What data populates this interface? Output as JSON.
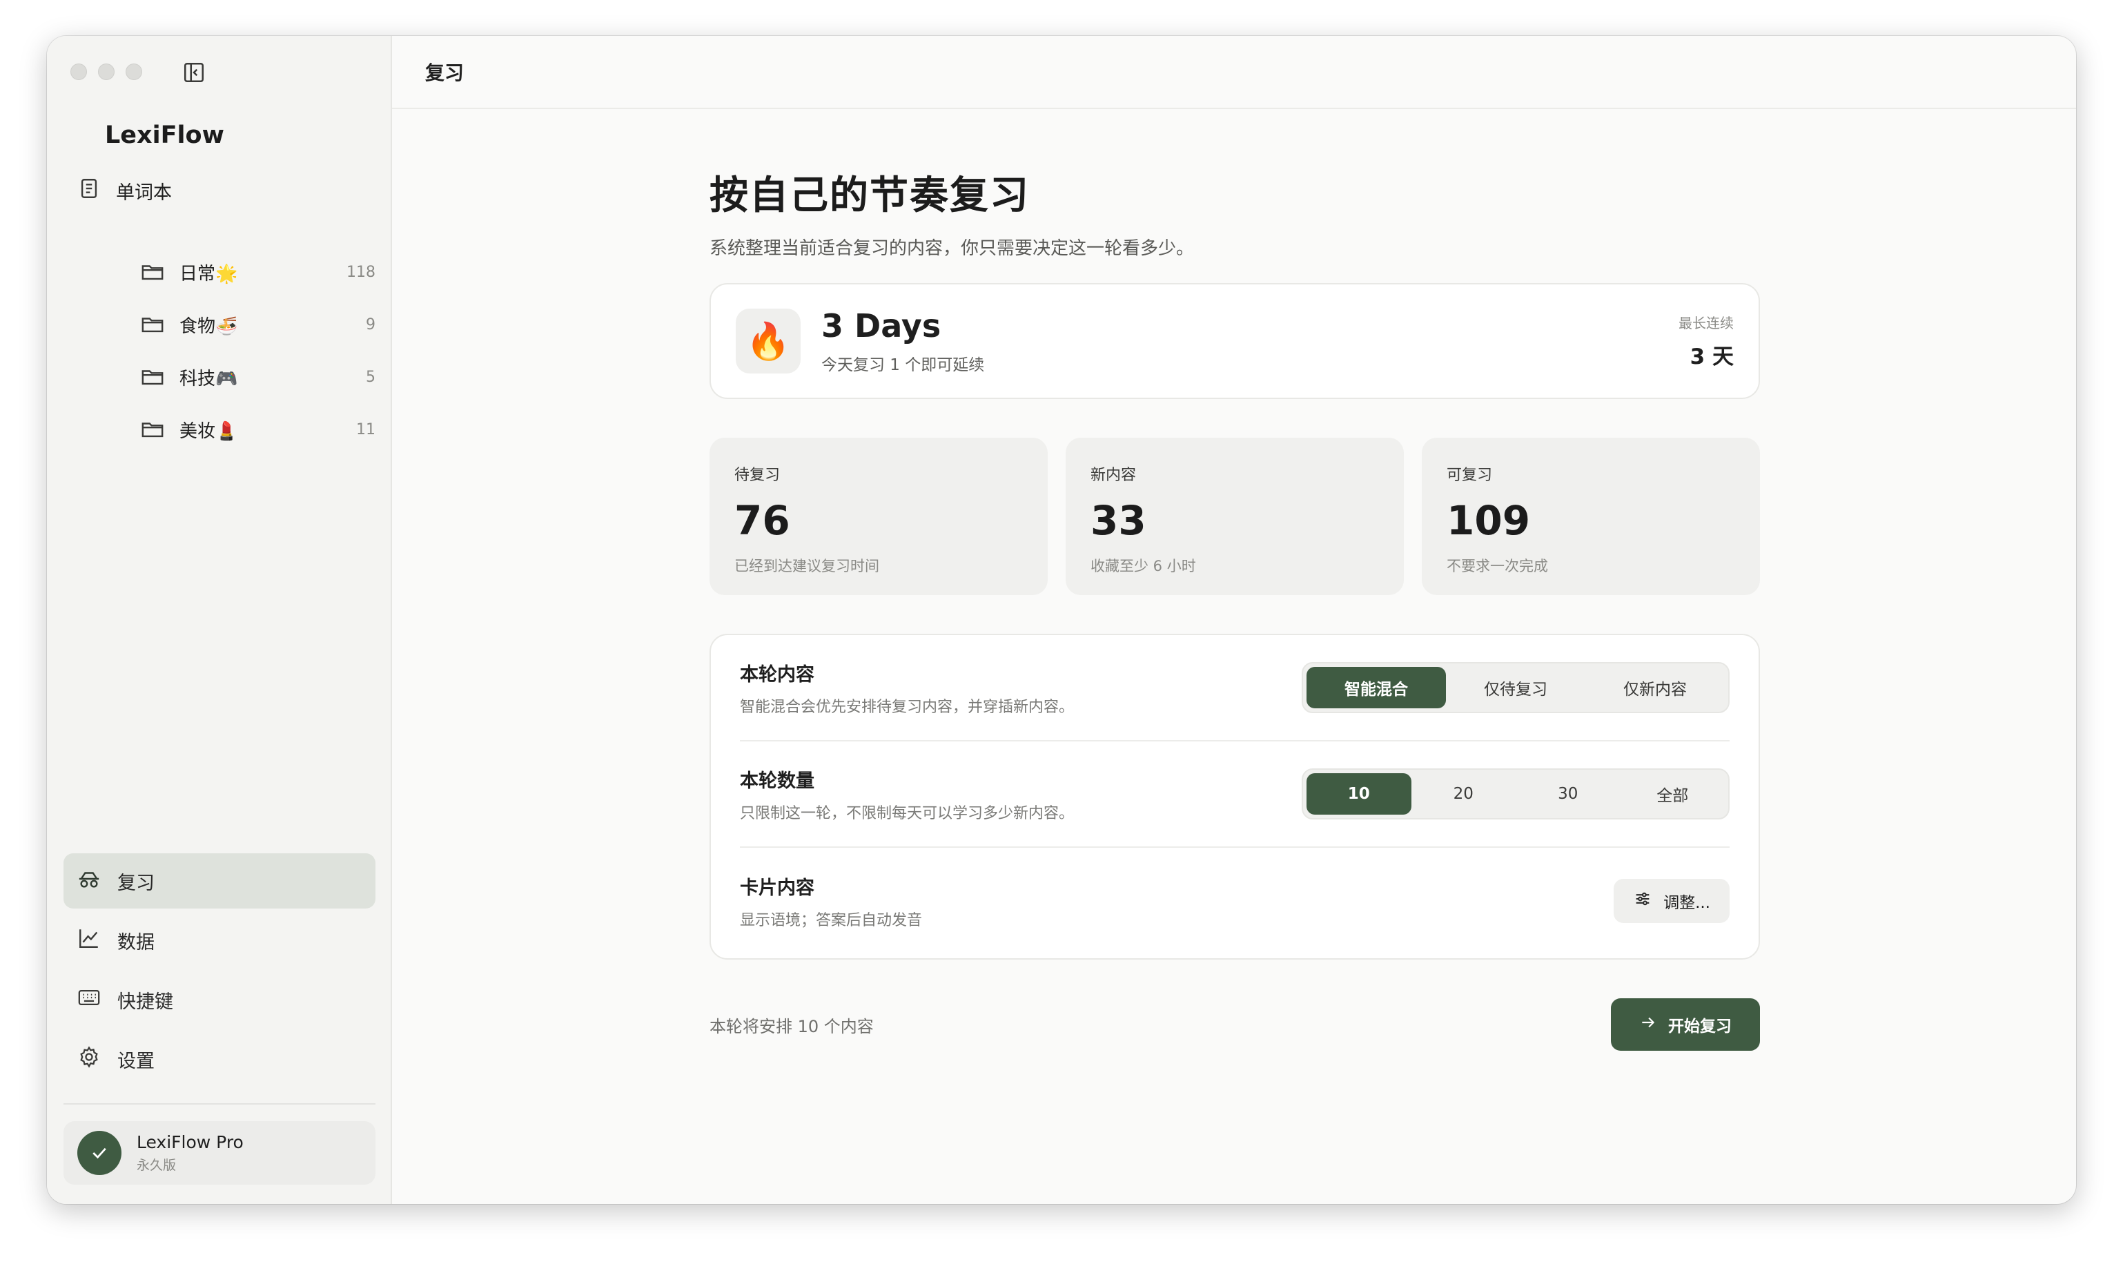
{
  "app": {
    "name": "LexiFlow"
  },
  "sidebar": {
    "wordbook_label": "单词本",
    "folders": [
      {
        "name": "日常🌟",
        "count": "118"
      },
      {
        "name": "食物🍜",
        "count": "9"
      },
      {
        "name": "科技🎮",
        "count": "5"
      },
      {
        "name": "美妆💄",
        "count": "11"
      }
    ],
    "nav": [
      {
        "label": "复习",
        "icon": "review-icon",
        "active": true
      },
      {
        "label": "数据",
        "icon": "chart-icon",
        "active": false
      },
      {
        "label": "快捷键",
        "icon": "keyboard-icon",
        "active": false
      },
      {
        "label": "设置",
        "icon": "gear-icon",
        "active": false
      }
    ],
    "pro": {
      "title": "LexiFlow Pro",
      "subtitle": "永久版"
    }
  },
  "header": {
    "title": "复习"
  },
  "main": {
    "heading": "按自己的节奏复习",
    "subheading": "系统整理当前适合复习的内容，你只需要决定这一轮看多少。",
    "streak": {
      "icon": "🔥",
      "title": "3 Days",
      "hint": "今天复习 1 个即可延续",
      "best_label": "最长连续",
      "best_value": "3 天"
    },
    "stats": [
      {
        "label": "待复习",
        "value": "76",
        "note": "已经到达建议复习时间"
      },
      {
        "label": "新内容",
        "value": "33",
        "note": "收藏至少 6 小时"
      },
      {
        "label": "可复习",
        "value": "109",
        "note": "不要求一次完成"
      }
    ],
    "options": {
      "content": {
        "title": "本轮内容",
        "desc": "智能混合会优先安排待复习内容，并穿插新内容。",
        "choices": [
          "智能混合",
          "仅待复习",
          "仅新内容"
        ],
        "selected": "智能混合"
      },
      "quantity": {
        "title": "本轮数量",
        "desc": "只限制这一轮，不限制每天可以学习多少新内容。",
        "choices": [
          "10",
          "20",
          "30",
          "全部"
        ],
        "selected": "10"
      },
      "card": {
        "title": "卡片内容",
        "desc": "显示语境；答案后自动发音",
        "button_label": "调整..."
      }
    },
    "footer": {
      "note": "本轮将安排 10 个内容",
      "start_label": "开始复习"
    }
  },
  "colors": {
    "accent": "#3f5b42",
    "active_nav_bg": "#dee2dc"
  }
}
